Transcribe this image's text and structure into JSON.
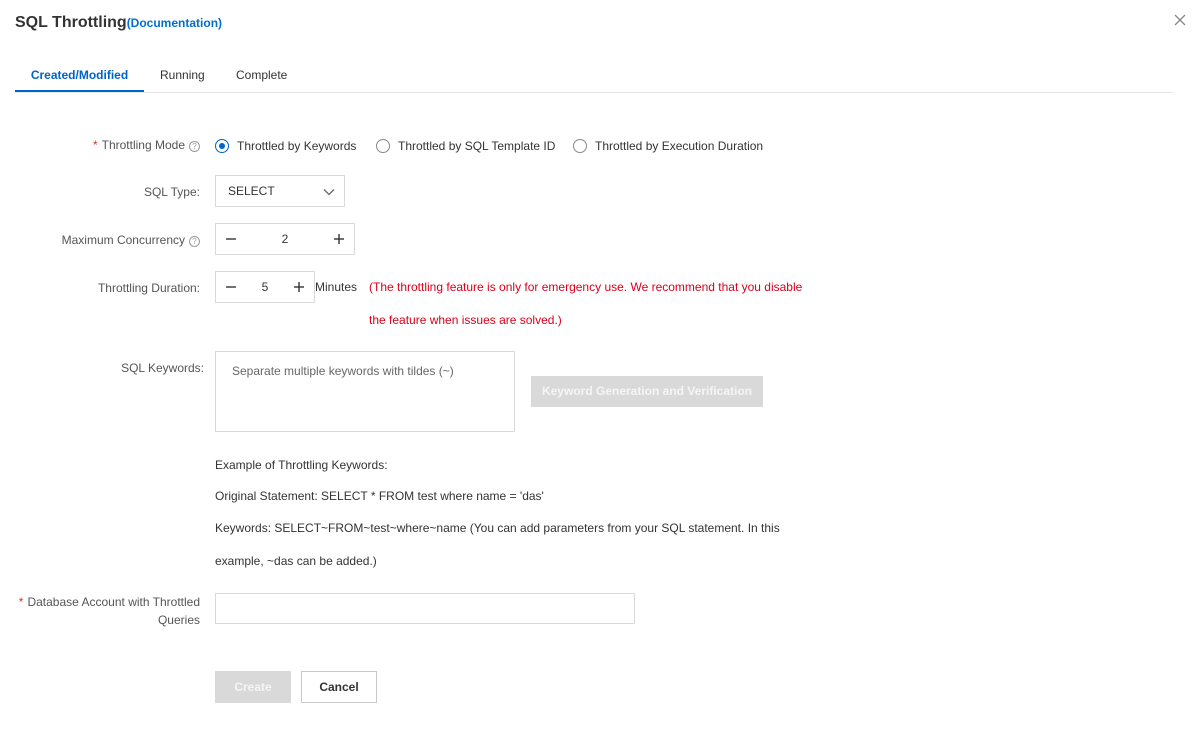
{
  "header": {
    "title": "SQL Throttling",
    "doc_link": "(Documentation)"
  },
  "tabs": [
    {
      "label": "Created/Modified",
      "active": true
    },
    {
      "label": "Running",
      "active": false
    },
    {
      "label": "Complete",
      "active": false
    }
  ],
  "form": {
    "throttling_mode": {
      "label": "Throttling Mode",
      "options": [
        {
          "label": "Throttled by Keywords",
          "selected": true
        },
        {
          "label": "Throttled by SQL Template ID",
          "selected": false
        },
        {
          "label": "Throttled by Execution Duration",
          "selected": false
        }
      ]
    },
    "sql_type": {
      "label": "SQL Type:",
      "value": "SELECT"
    },
    "max_concurrency": {
      "label": "Maximum Concurrency",
      "value": "2"
    },
    "throttling_duration": {
      "label": "Throttling Duration:",
      "value": "5",
      "unit": "Minutes",
      "warning_line1": "(The throttling feature is only for emergency use. We recommend that you disable",
      "warning_line2": "the feature when issues are solved.)"
    },
    "sql_keywords": {
      "label": "SQL Keywords:",
      "placeholder": "Separate multiple keywords with tildes (~)",
      "generate_button": "Keyword Generation and Verification"
    },
    "example": {
      "heading": "Example of Throttling Keywords:",
      "original": "Original Statement: SELECT * FROM test where name = 'das'",
      "keywords_line1": "Keywords: SELECT~FROM~test~where~name (You can add parameters from your SQL statement. In this",
      "keywords_line2": "example, ~das can be added.)"
    },
    "db_account": {
      "label_line1": "Database Account with Throttled",
      "label_line2": "Queries",
      "value": ""
    }
  },
  "actions": {
    "create": "Create",
    "cancel": "Cancel"
  },
  "colors": {
    "accent": "#0064c8",
    "link": "#0070cc",
    "warning": "#d9001b",
    "required": "#d93026",
    "disabled_bg": "#d9d9d9"
  },
  "icons": {
    "close": "close-icon",
    "help": "question-circle-icon",
    "dropdown": "chevron-down-icon",
    "minus": "minus-icon",
    "plus": "plus-icon"
  }
}
